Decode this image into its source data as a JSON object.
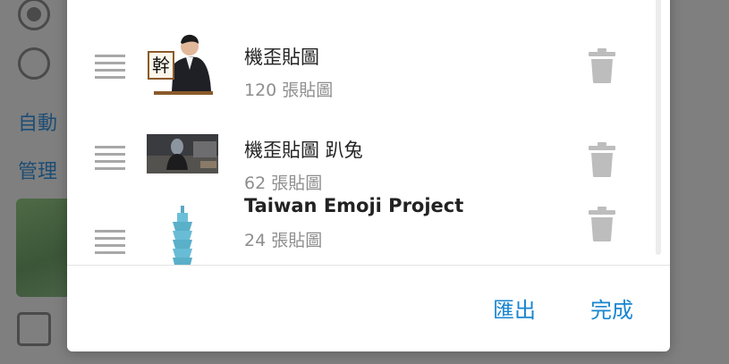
{
  "background": {
    "link1": "自動",
    "link2": "管理",
    "radio_selected_icon": "radio-selected-icon",
    "radio_unselected_icon": "radio-unselected-icon",
    "checkbox_icon": "checkbox-icon"
  },
  "dialog": {
    "items": [
      {
        "title": "機歪貼圖",
        "count": "120 張貼圖",
        "thumb_char": "幹"
      },
      {
        "title": "機歪貼圖 趴兔",
        "count": "62 張貼圖"
      },
      {
        "title": "Taiwan Emoji Project",
        "count": "24 張貼圖"
      }
    ],
    "export_label": "匯出",
    "done_label": "完成",
    "icons": {
      "drag": "drag-handle-icon",
      "delete": "trash-icon"
    }
  }
}
